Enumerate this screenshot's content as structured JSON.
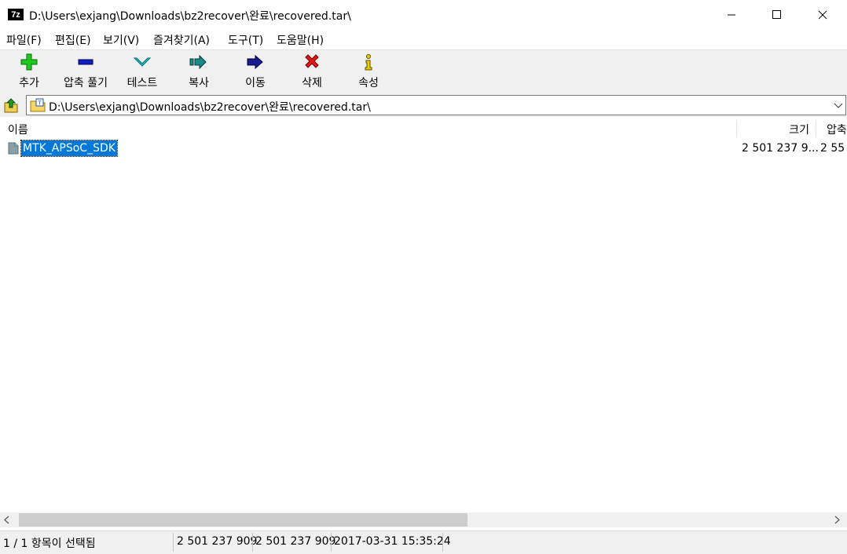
{
  "window": {
    "app_icon_text": "7z",
    "title": "D:\\Users\\exjang\\Downloads\\bz2recover\\완료\\recovered.tar\\"
  },
  "menu": [
    {
      "label": "파일(F)"
    },
    {
      "label": "편집(E)"
    },
    {
      "label": "보기(V)"
    },
    {
      "label": "즐겨찾기(A)"
    },
    {
      "label": "도구(T)"
    },
    {
      "label": "도움말(H)"
    }
  ],
  "toolbar": [
    {
      "label": "추가",
      "icon": "plus-icon",
      "color": "#1ec81e"
    },
    {
      "label": "압축 풀기",
      "icon": "minus-icon",
      "color": "#1020c0"
    },
    {
      "label": "테스트",
      "icon": "check-down-icon",
      "color": "#18c8d0"
    },
    {
      "label": "복사",
      "icon": "double-arrow-icon",
      "color": "#1a8a8a"
    },
    {
      "label": "이동",
      "icon": "arrow-right-icon",
      "color": "#1a1a8a"
    },
    {
      "label": "삭제",
      "icon": "x-icon",
      "color": "#e01818"
    },
    {
      "label": "속성",
      "icon": "info-icon",
      "color": "#e8d000"
    }
  ],
  "address": {
    "path": "D:\\Users\\exjang\\Downloads\\bz2recover\\완료\\recovered.tar\\"
  },
  "columns": {
    "name": "이름",
    "size": "크기",
    "packed": "압축"
  },
  "files": [
    {
      "name": "MTK_APSoC_SDK",
      "size": "2 501 237 9...",
      "packed": "2 55"
    }
  ],
  "status": {
    "selection": "1 / 1 항목이 선택됨",
    "size": "2 501 237 909",
    "packed": "2 501 237 909",
    "modified": "2017-03-31 15:35:24"
  }
}
